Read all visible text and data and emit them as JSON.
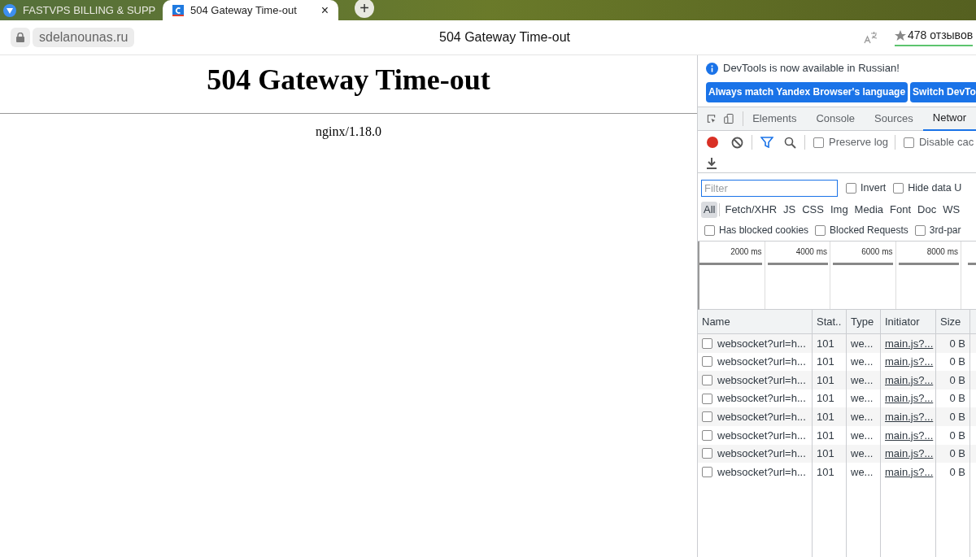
{
  "browser_tabs": [
    {
      "title": "FASTVPS BILLING & SUPP",
      "selected": false
    },
    {
      "title": "504 Gateway Time-out",
      "selected": true,
      "close": "×"
    }
  ],
  "new_tab": "+",
  "address_bar": {
    "domain": "sdelanounas.ru",
    "title": "504 Gateway Time-out",
    "reviews": "478 отзывов"
  },
  "page": {
    "heading": "504 Gateway Time-out",
    "server": "nginx/1.18.0"
  },
  "devtools": {
    "notice": "DevTools is now available in Russian!",
    "notice_buttons": [
      "Always match Yandex Browser's language",
      "Switch DevTo"
    ],
    "panel_tabs": [
      {
        "label": "Elements",
        "selected": false
      },
      {
        "label": "Console",
        "selected": false
      },
      {
        "label": "Sources",
        "selected": false
      },
      {
        "label": "Networ",
        "selected": true
      }
    ],
    "recording": true,
    "toolbar_checks": [
      {
        "label": "Preserve log",
        "checked": false
      },
      {
        "label": "Disable cac",
        "checked": false
      }
    ],
    "filter": {
      "placeholder": "Filter"
    },
    "filter_checks": [
      {
        "label": "Invert",
        "checked": false
      },
      {
        "label": "Hide data U",
        "checked": false
      }
    ],
    "type_filters": [
      {
        "label": "All",
        "selected": true
      },
      {
        "label": "Fetch/XHR",
        "selected": false
      },
      {
        "label": "JS",
        "selected": false
      },
      {
        "label": "CSS",
        "selected": false
      },
      {
        "label": "Img",
        "selected": false
      },
      {
        "label": "Media",
        "selected": false
      },
      {
        "label": "Font",
        "selected": false
      },
      {
        "label": "Doc",
        "selected": false
      },
      {
        "label": "WS",
        "selected": false
      }
    ],
    "blocked_checks": [
      {
        "label": "Has blocked cookies",
        "checked": false
      },
      {
        "label": "Blocked Requests",
        "checked": false
      },
      {
        "label": "3rd-par",
        "checked": false
      }
    ],
    "timeline_ticks": [
      "2000 ms",
      "4000 ms",
      "6000 ms",
      "8000 ms"
    ],
    "table": {
      "columns": [
        "Name",
        "Stat..",
        "Type",
        "Initiator",
        "Size"
      ],
      "rows": [
        {
          "name": "websocket?url=h...",
          "status": "101",
          "type": "we...",
          "initiator": "main.js?...",
          "size": "0 B",
          "checked": false
        },
        {
          "name": "websocket?url=h...",
          "status": "101",
          "type": "we...",
          "initiator": "main.js?...",
          "size": "0 B",
          "checked": false
        },
        {
          "name": "websocket?url=h...",
          "status": "101",
          "type": "we...",
          "initiator": "main.js?...",
          "size": "0 B",
          "checked": false
        },
        {
          "name": "websocket?url=h...",
          "status": "101",
          "type": "we...",
          "initiator": "main.js?...",
          "size": "0 B",
          "checked": false
        },
        {
          "name": "websocket?url=h...",
          "status": "101",
          "type": "we...",
          "initiator": "main.js?...",
          "size": "0 B",
          "checked": false
        },
        {
          "name": "websocket?url=h...",
          "status": "101",
          "type": "we...",
          "initiator": "main.js?...",
          "size": "0 B",
          "checked": false
        },
        {
          "name": "websocket?url=h...",
          "status": "101",
          "type": "we...",
          "initiator": "main.js?...",
          "size": "0 B",
          "checked": false
        },
        {
          "name": "websocket?url=h...",
          "status": "101",
          "type": "we...",
          "initiator": "main.js?...",
          "size": "0 B",
          "checked": false
        }
      ]
    }
  }
}
